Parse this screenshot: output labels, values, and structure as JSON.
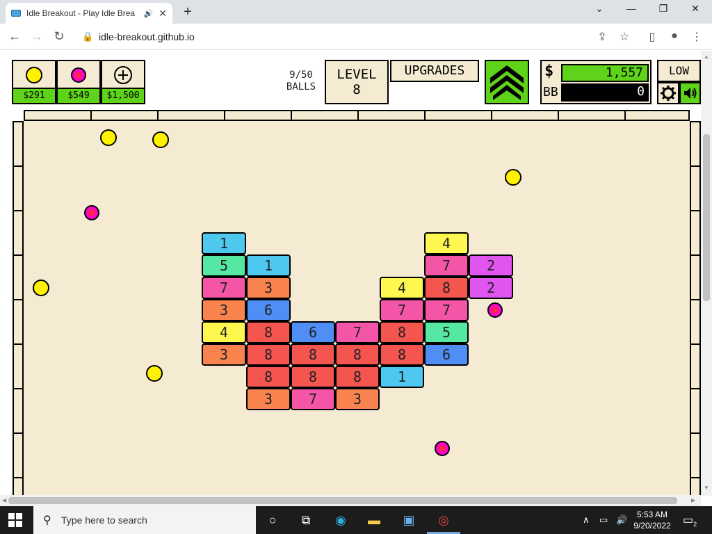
{
  "browser": {
    "tab_title": "Idle Breakout - Play Idle Brea",
    "url": "idle-breakout.github.io"
  },
  "hud": {
    "buy": [
      {
        "type": "yellow-ball",
        "price": "$291"
      },
      {
        "type": "pink-ball",
        "price": "$549"
      },
      {
        "type": "add-ball",
        "price": "$1,500"
      }
    ],
    "balls_line1": "9/50",
    "balls_line2": "BALLS",
    "level_line1": "LEVEL",
    "level_line2": "8",
    "upgrades_label": "UPGRADES",
    "money_symbol": "$",
    "money_value": "1,557",
    "bb_symbol": "BB",
    "bb_value": "0",
    "quality_label": "LOW"
  },
  "colors": {
    "green": "#5fd31a",
    "field": "#f4ebd2",
    "cyan": "#4fc8f0",
    "mint": "#55e8a3",
    "pink": "#f455a6",
    "orange": "#f9834f",
    "red": "#f4554f",
    "blue": "#4f8ef4",
    "yellow": "#fdf74f",
    "magenta": "#e055f0"
  },
  "bricks": [
    {
      "col": 0,
      "row": 0,
      "value": "1",
      "color": "cyan"
    },
    {
      "col": 5,
      "row": 0,
      "value": "4",
      "color": "yellow"
    },
    {
      "col": 0,
      "row": 1,
      "value": "5",
      "color": "mint"
    },
    {
      "col": 1,
      "row": 1,
      "value": "1",
      "color": "cyan"
    },
    {
      "col": 5,
      "row": 1,
      "value": "7",
      "color": "pink"
    },
    {
      "col": 6,
      "row": 1,
      "value": "2",
      "color": "magenta"
    },
    {
      "col": 0,
      "row": 2,
      "value": "7",
      "color": "pink"
    },
    {
      "col": 1,
      "row": 2,
      "value": "3",
      "color": "orange"
    },
    {
      "col": 4,
      "row": 2,
      "value": "4",
      "color": "yellow"
    },
    {
      "col": 5,
      "row": 2,
      "value": "8",
      "color": "red"
    },
    {
      "col": 6,
      "row": 2,
      "value": "2",
      "color": "magenta"
    },
    {
      "col": 0,
      "row": 3,
      "value": "3",
      "color": "orange"
    },
    {
      "col": 1,
      "row": 3,
      "value": "6",
      "color": "blue"
    },
    {
      "col": 4,
      "row": 3,
      "value": "7",
      "color": "pink"
    },
    {
      "col": 5,
      "row": 3,
      "value": "7",
      "color": "pink"
    },
    {
      "col": 0,
      "row": 4,
      "value": "4",
      "color": "yellow"
    },
    {
      "col": 1,
      "row": 4,
      "value": "8",
      "color": "red"
    },
    {
      "col": 2,
      "row": 4,
      "value": "6",
      "color": "blue"
    },
    {
      "col": 3,
      "row": 4,
      "value": "7",
      "color": "pink"
    },
    {
      "col": 4,
      "row": 4,
      "value": "8",
      "color": "red"
    },
    {
      "col": 5,
      "row": 4,
      "value": "5",
      "color": "mint"
    },
    {
      "col": 0,
      "row": 5,
      "value": "3",
      "color": "orange"
    },
    {
      "col": 1,
      "row": 5,
      "value": "8",
      "color": "red"
    },
    {
      "col": 2,
      "row": 5,
      "value": "8",
      "color": "red"
    },
    {
      "col": 3,
      "row": 5,
      "value": "8",
      "color": "red"
    },
    {
      "col": 4,
      "row": 5,
      "value": "8",
      "color": "red"
    },
    {
      "col": 5,
      "row": 5,
      "value": "6",
      "color": "blue"
    },
    {
      "col": 1,
      "row": 6,
      "value": "8",
      "color": "red"
    },
    {
      "col": 2,
      "row": 6,
      "value": "8",
      "color": "red"
    },
    {
      "col": 3,
      "row": 6,
      "value": "8",
      "color": "red"
    },
    {
      "col": 4,
      "row": 6,
      "value": "1",
      "color": "cyan"
    },
    {
      "col": 1,
      "row": 7,
      "value": "3",
      "color": "orange"
    },
    {
      "col": 2,
      "row": 7,
      "value": "7",
      "color": "pink"
    },
    {
      "col": 3,
      "row": 7,
      "value": "3",
      "color": "orange"
    }
  ],
  "balls": [
    {
      "kind": "yellow"
    },
    {
      "kind": "yellow"
    },
    {
      "kind": "yellow"
    },
    {
      "kind": "pink"
    },
    {
      "kind": "yellow"
    },
    {
      "kind": "pink"
    },
    {
      "kind": "yellow"
    },
    {
      "kind": "pink"
    }
  ],
  "taskbar": {
    "search_placeholder": "Type here to search",
    "time": "5:53 AM",
    "date": "9/20/2022",
    "notification_count": "2"
  }
}
